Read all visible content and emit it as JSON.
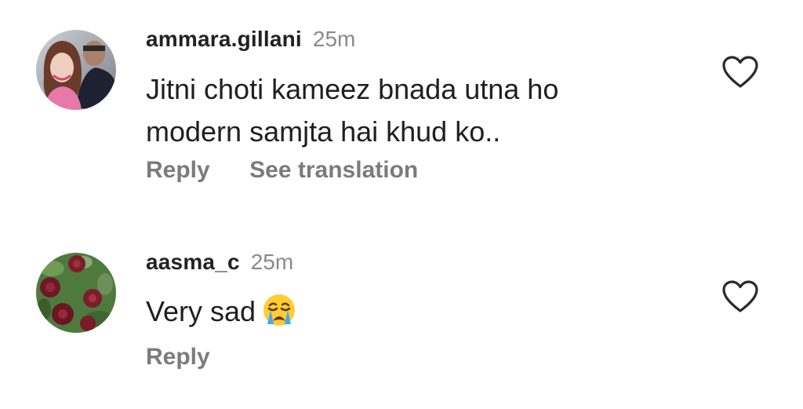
{
  "comments": [
    {
      "username": "ammara.gillani",
      "timestamp": "25m",
      "text_line1": "Jitni choti kameez bnada utna ho",
      "text_line2": "modern samjta hai khud ko..",
      "actions": [
        "Reply",
        "See translation"
      ],
      "like_icon": "heart-outline-icon",
      "avatar": "profile-photo-couple"
    },
    {
      "username": "aasma_c",
      "timestamp": "25m",
      "text": "Very sad",
      "emoji": "loudly-crying-face",
      "actions": [
        "Reply"
      ],
      "like_icon": "heart-outline-icon",
      "avatar": "profile-photo-red-roses"
    }
  ],
  "colors": {
    "username": "#222222",
    "timestamp": "#8a8a8a",
    "body_text": "#1f1f1f",
    "action_text": "#7b7b7b",
    "background": "#ffffff"
  }
}
